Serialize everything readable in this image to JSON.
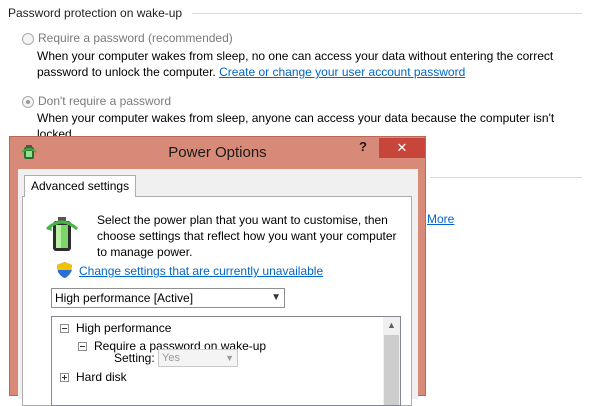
{
  "background": {
    "section_title": "Password protection on wake-up",
    "option_require": {
      "label": "Require a password (recommended)",
      "desc": "When your computer wakes from sleep, no one can access your data without entering the correct password to unlock the computer.",
      "link": "Create or change your user account password"
    },
    "option_no_require": {
      "label": "Don't require a password",
      "desc": "When your computer wakes from sleep, anyone can access your data because the computer isn't locked."
    },
    "partial_link": "More"
  },
  "dialog": {
    "title": "Power Options",
    "help_label": "?",
    "close_label": "✕",
    "tab_label": "Advanced settings",
    "intro_text": "Select the power plan that you want to customise, then choose settings that reflect how you want your computer to manage power.",
    "change_link": "Change settings that are currently unavailable",
    "plan_select": {
      "selected": "High performance [Active]"
    },
    "tree": [
      {
        "label": "High performance"
      },
      {
        "label": "Require a password on wake-up"
      },
      {
        "setting_label": "Setting:",
        "value": "Yes"
      },
      {
        "label": "Hard disk"
      }
    ],
    "colors": {
      "title_bar": "#d88a78",
      "close_button": "#c7453a",
      "link": "#0066cc"
    }
  }
}
